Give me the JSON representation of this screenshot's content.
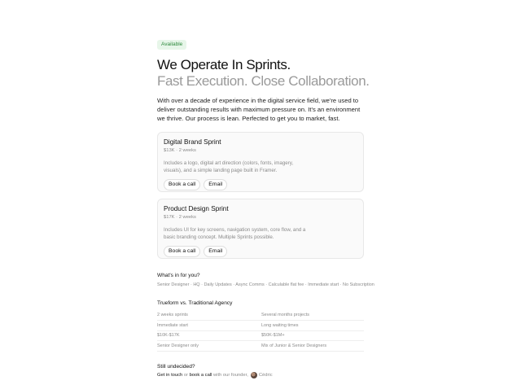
{
  "badge": "Available",
  "hero": {
    "title": "We Operate In Sprints.",
    "subtitle": "Fast Execution. Close Collaboration.",
    "lead": "With over a decade of experience in the digital service field, we're used to deliver outstanding results with maximum pressure on. It's an environment we thrive. Our process is lean. Perfected to get you to market, fast."
  },
  "cards": [
    {
      "title": "Digital Brand Sprint",
      "meta": "$13K · 2 weeks",
      "desc": "Includes a logo, digital art direction (colors, fonts, imagery, visuals), and a simple landing page built in Framer.",
      "book_label": "Book a call",
      "email_label": "Email"
    },
    {
      "title": "Product Design Sprint",
      "meta": "$17K · 2 weeks",
      "desc": "Includes UI for key screens, navigation system, core flow, and a basic branding concept. Multiple Sprints possible.",
      "book_label": "Book a call",
      "email_label": "Email"
    }
  ],
  "benefits": {
    "title": "What's in for you?",
    "list": "Senior Designer · HQ · Daily Updates · Async Comms · Calculable flat fee · Immediate start · No Subscription"
  },
  "comparison": {
    "title": "Trueform vs. Traditional Agency",
    "rows": [
      [
        "2 weeks sprints",
        "Several months projects"
      ],
      [
        "Immediate start",
        "Long waiting times"
      ],
      [
        "$10K-$17K",
        "$50K-$1M+"
      ],
      [
        "Senior Designer only",
        "Mix of Junior & Senior Designers"
      ]
    ]
  },
  "footer": {
    "title": "Still undecided?",
    "get_in_touch": "Get in touch",
    "or": " or ",
    "book_call": "book a call",
    "with_founder": " with our founder,",
    "founder_name": "Cédric"
  }
}
